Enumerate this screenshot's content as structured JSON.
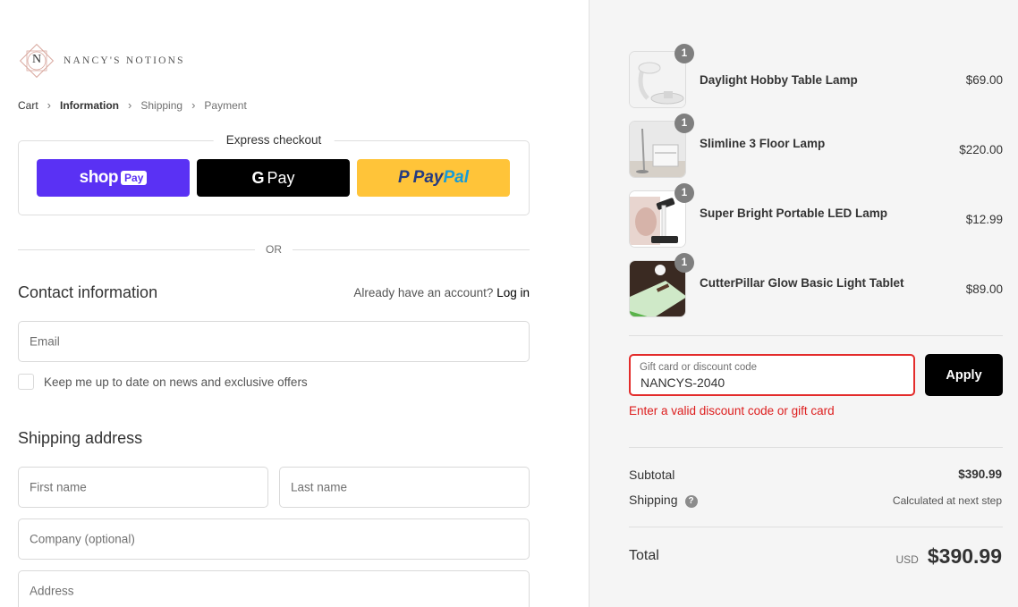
{
  "brand": {
    "name": "NANCY'S NOTIONS",
    "monogram": "N"
  },
  "breadcrumb": [
    "Cart",
    "Information",
    "Shipping",
    "Payment"
  ],
  "express": {
    "title": "Express checkout",
    "shoppay": {
      "word": "shop",
      "badge": "Pay"
    },
    "gpay": {
      "g": "G",
      "label": "Pay"
    },
    "paypal": {
      "mark": "P",
      "a": "Pay",
      "b": "Pal"
    }
  },
  "or_label": "OR",
  "contact": {
    "title": "Contact information",
    "account_text": "Already have an account?",
    "login_label": "Log in",
    "email_placeholder": "Email",
    "newsletter_label": "Keep me up to date on news and exclusive offers"
  },
  "shipping": {
    "title": "Shipping address",
    "first_name_placeholder": "First name",
    "last_name_placeholder": "Last name",
    "company_placeholder": "Company (optional)",
    "address_placeholder": "Address"
  },
  "cart": {
    "items": [
      {
        "name": "Daylight Hobby Table Lamp",
        "price": "$69.00",
        "qty": "1"
      },
      {
        "name": "Slimline 3 Floor Lamp",
        "price": "$220.00",
        "qty": "1"
      },
      {
        "name": "Super Bright Portable LED Lamp",
        "price": "$12.99",
        "qty": "1"
      },
      {
        "name": "CutterPillar Glow Basic Light Tablet",
        "price": "$89.00",
        "qty": "1"
      }
    ]
  },
  "discount": {
    "label": "Gift card or discount code",
    "value": "NANCYS-2040",
    "apply_label": "Apply",
    "error": "Enter a valid discount code or gift card"
  },
  "summary": {
    "subtotal_label": "Subtotal",
    "subtotal_value": "$390.99",
    "shipping_label": "Shipping",
    "shipping_value": "Calculated at next step",
    "total_label": "Total",
    "currency": "USD",
    "total_value": "$390.99"
  },
  "colors": {
    "shoppay": "#5a31f4",
    "paypal": "#ffc439",
    "error": "#e32c2b",
    "sidebar": "#f5f5f5"
  }
}
